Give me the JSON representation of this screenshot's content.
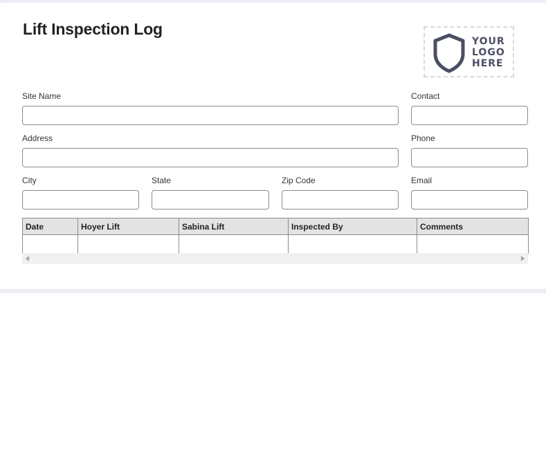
{
  "form": {
    "title": "Lift Inspection Log",
    "logo": {
      "lines": [
        "YOUR",
        "LOGO",
        "HERE"
      ],
      "icon": "shield-icon",
      "color": "#4a4f63"
    },
    "fields": {
      "site_name": {
        "label": "Site Name",
        "value": ""
      },
      "contact": {
        "label": "Contact",
        "value": ""
      },
      "address": {
        "label": "Address",
        "value": ""
      },
      "phone": {
        "label": "Phone",
        "value": ""
      },
      "city": {
        "label": "City",
        "value": ""
      },
      "state": {
        "label": "State",
        "value": ""
      },
      "zip": {
        "label": "Zip Code",
        "value": ""
      },
      "email": {
        "label": "Email",
        "value": ""
      }
    },
    "table": {
      "columns": [
        "Date",
        "Hoyer Lift",
        "Sabina Lift",
        "Inspected By",
        "Comments"
      ],
      "rows": [
        [
          "",
          "",
          "",
          "",
          ""
        ]
      ]
    }
  }
}
